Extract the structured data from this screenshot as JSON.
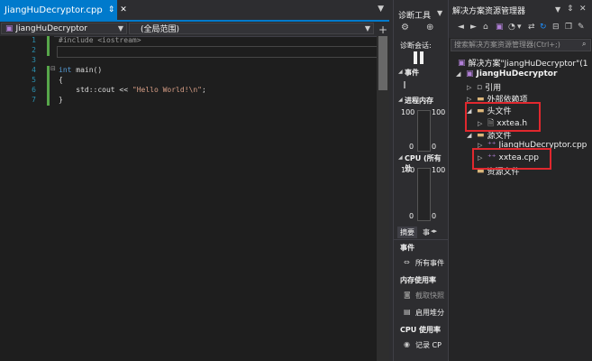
{
  "editor": {
    "tab_title": "JiangHuDecryptor.cpp",
    "tab_pin": "⇕",
    "tab_close": "✕",
    "project_combo": "JiangHuDecryptor",
    "scope_combo": "(全局范围)",
    "line_numbers": [
      "1",
      "2",
      "3",
      "4",
      "5",
      "6",
      "7"
    ],
    "code": {
      "line1": "#include <iostream>",
      "line4_kw": "int",
      "line4_rest": " main()",
      "line5": "{",
      "line6_pre": "    std::cout << ",
      "line6_str": "\"Hello World!\\n\"",
      "line6_post": ";",
      "line7": "}"
    },
    "colors": {
      "keyword": "#569cd6",
      "string": "#d69d85",
      "include": "#9b9b9b",
      "linenum": "#2b91af",
      "accent": "#007acc"
    }
  },
  "diag": {
    "title": "诊断工具",
    "session": "诊断会话:",
    "events": "事件",
    "memory": "进程内存",
    "mem_top": "100",
    "mem_bottom": "0",
    "mem_top_r": "100",
    "mem_bottom_r": "0",
    "cpu": "CPU (所有处",
    "cpu_top": "100",
    "cpu_bottom": "0",
    "cpu_top_r": "100",
    "cpu_bottom_r": "0",
    "tab_summary": "摘要",
    "tab_events": "事",
    "events2": "事件",
    "all_events": "所有事件",
    "mem_usage": "内存使用率",
    "snapshot": "截取快照",
    "heap": "启用堆分",
    "cpu_usage": "CPU 使用率",
    "record_cpu": "记录 CP"
  },
  "solution": {
    "title": "解决方案资源管理器",
    "search_placeholder": "搜索解决方案资源管理器(Ctrl+;)",
    "root": "解决方案\"JiangHuDecryptor\"(1",
    "project": "JiangHuDecryptor",
    "refs": "引用",
    "external": "外部依赖项",
    "headers": "头文件",
    "header_file": "xxtea.h",
    "sources": "源文件",
    "source1": "JiangHuDecryptor.cpp",
    "source2": "xxtea.cpp",
    "resources": "资源文件",
    "highlight_color": "#e0282e"
  }
}
